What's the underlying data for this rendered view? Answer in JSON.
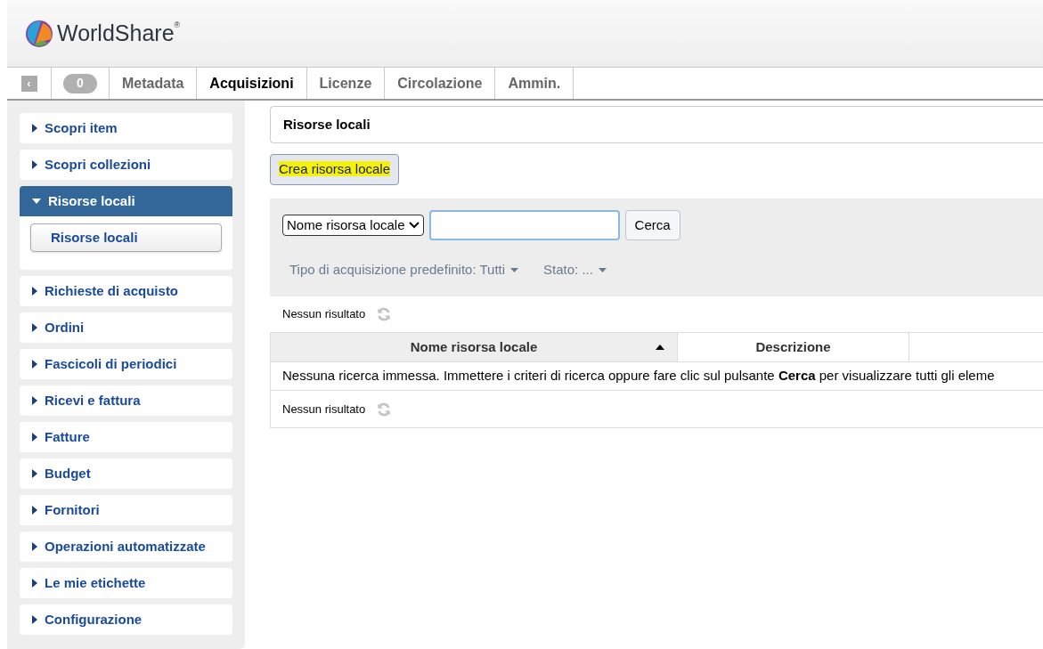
{
  "header": {
    "logo_text": "WorldShare",
    "logo_mark": "®"
  },
  "nav": {
    "collapse": "‹",
    "count": "0",
    "tabs": [
      {
        "label": "Metadata",
        "selected": false
      },
      {
        "label": "Acquisizioni",
        "selected": true
      },
      {
        "label": "Licenze",
        "selected": false
      },
      {
        "label": "Circolazione",
        "selected": false
      },
      {
        "label": "Ammin.",
        "selected": false
      }
    ]
  },
  "sidebar": {
    "items": [
      {
        "label": "Scopri item",
        "expanded": false
      },
      {
        "label": "Scopri collezioni",
        "expanded": false
      },
      {
        "label": "Risorse locali",
        "expanded": true,
        "children": [
          {
            "label": "Risorse locali"
          }
        ]
      },
      {
        "label": "Richieste di acquisto",
        "expanded": false
      },
      {
        "label": "Ordini",
        "expanded": false
      },
      {
        "label": "Fascicoli di periodici",
        "expanded": false
      },
      {
        "label": "Ricevi e fattura",
        "expanded": false
      },
      {
        "label": "Fatture",
        "expanded": false
      },
      {
        "label": "Budget",
        "expanded": false
      },
      {
        "label": "Fornitori",
        "expanded": false
      },
      {
        "label": "Operazioni automatizzate",
        "expanded": false
      },
      {
        "label": "Le mie etichette",
        "expanded": false
      },
      {
        "label": "Configurazione",
        "expanded": false
      }
    ]
  },
  "main": {
    "title": "Risorse locali",
    "create_button": {
      "label": "Crea risorsa locale",
      "highlighted": true
    },
    "search": {
      "field_select": "Nome risorsa locale",
      "button": "Cerca"
    },
    "filters": [
      "Tipo di acquisizione predefinito: Tutti",
      "Stato: ..."
    ],
    "result_count_top": "Nessun risultato",
    "table": {
      "columns": [
        {
          "label": "Nome risorsa locale",
          "sorted": true
        },
        {
          "label": "Descrizione",
          "sorted": false
        }
      ],
      "message": "Nessuna ricerca immessa. Immettere i criteri di ricerca oppure fare clic sul pulsante **Cerca** per visualizzare tutti gli eleme"
    },
    "result_count_bottom": "Nessun risultato"
  }
}
